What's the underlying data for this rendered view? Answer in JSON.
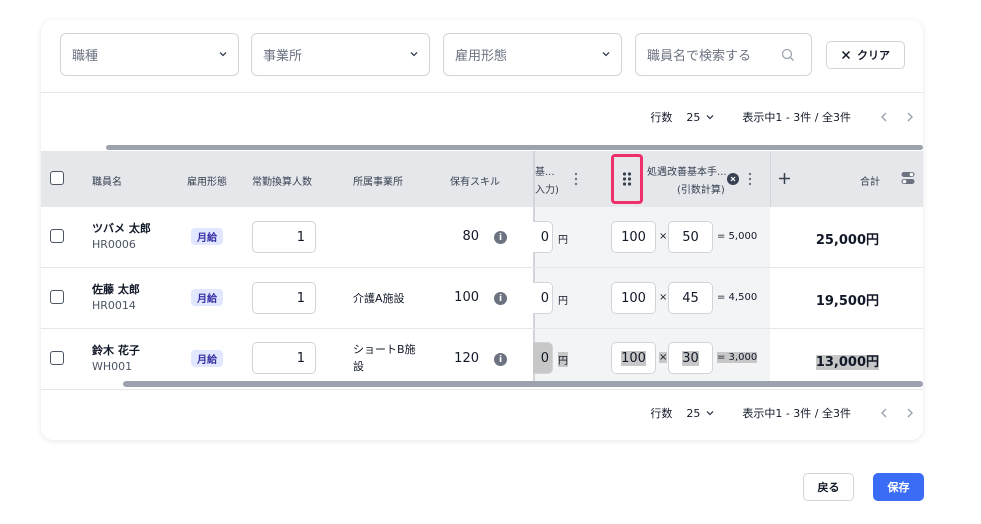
{
  "filters": {
    "job_type": "職種",
    "office": "事業所",
    "employment_type": "雇用形態",
    "search_placeholder": "職員名で検索する",
    "clear_label": "クリア"
  },
  "pagination_top": {
    "rows_label": "行数",
    "rows_value": "25",
    "range_text": "表示中1 - 3件 / 全3件"
  },
  "pagination_bottom": {
    "rows_label": "行数",
    "rows_value": "25",
    "range_text": "表示中1 - 3件 / 全3件"
  },
  "table": {
    "headers": {
      "name": "職員名",
      "employment": "雇用形態",
      "fte": "常勤換算人数",
      "office": "所属事業所",
      "skill": "保有スキル",
      "cut_col_line1": "基...",
      "cut_col_line2": "入力)",
      "improvement_line1": "処遇改善基本手...",
      "improvement_line2": "(引数計算)",
      "total": "合計"
    },
    "rows": [
      {
        "name": "ツバメ 太郎",
        "code": "HR0006",
        "employment": "月給",
        "fte": "1",
        "office": "",
        "skill": "80",
        "cut_value": "0",
        "yen": "円",
        "factor": "100",
        "times": "×",
        "amount": "50",
        "result": "= 5,000",
        "total": "25,000円"
      },
      {
        "name": "佐藤 太郎",
        "code": "HR0014",
        "employment": "月給",
        "fte": "1",
        "office": "介護A施設",
        "skill": "100",
        "cut_value": "0",
        "yen": "円",
        "factor": "100",
        "times": "×",
        "amount": "45",
        "result": "= 4,500",
        "total": "19,500円"
      },
      {
        "name": "鈴木 花子",
        "code": "WH001",
        "employment": "月給",
        "fte": "1",
        "office": "ショートB施設",
        "skill": "120",
        "cut_value": "0",
        "yen": "円",
        "factor": "100",
        "times": "×",
        "amount": "30",
        "result": "= 3,000",
        "total": "13,000円"
      }
    ]
  },
  "footer": {
    "back_label": "戻る",
    "save_label": "保存"
  },
  "colors": {
    "primary": "#3b6cf6",
    "highlight": "#f0306a",
    "badge_bg": "#e0e7ff"
  }
}
